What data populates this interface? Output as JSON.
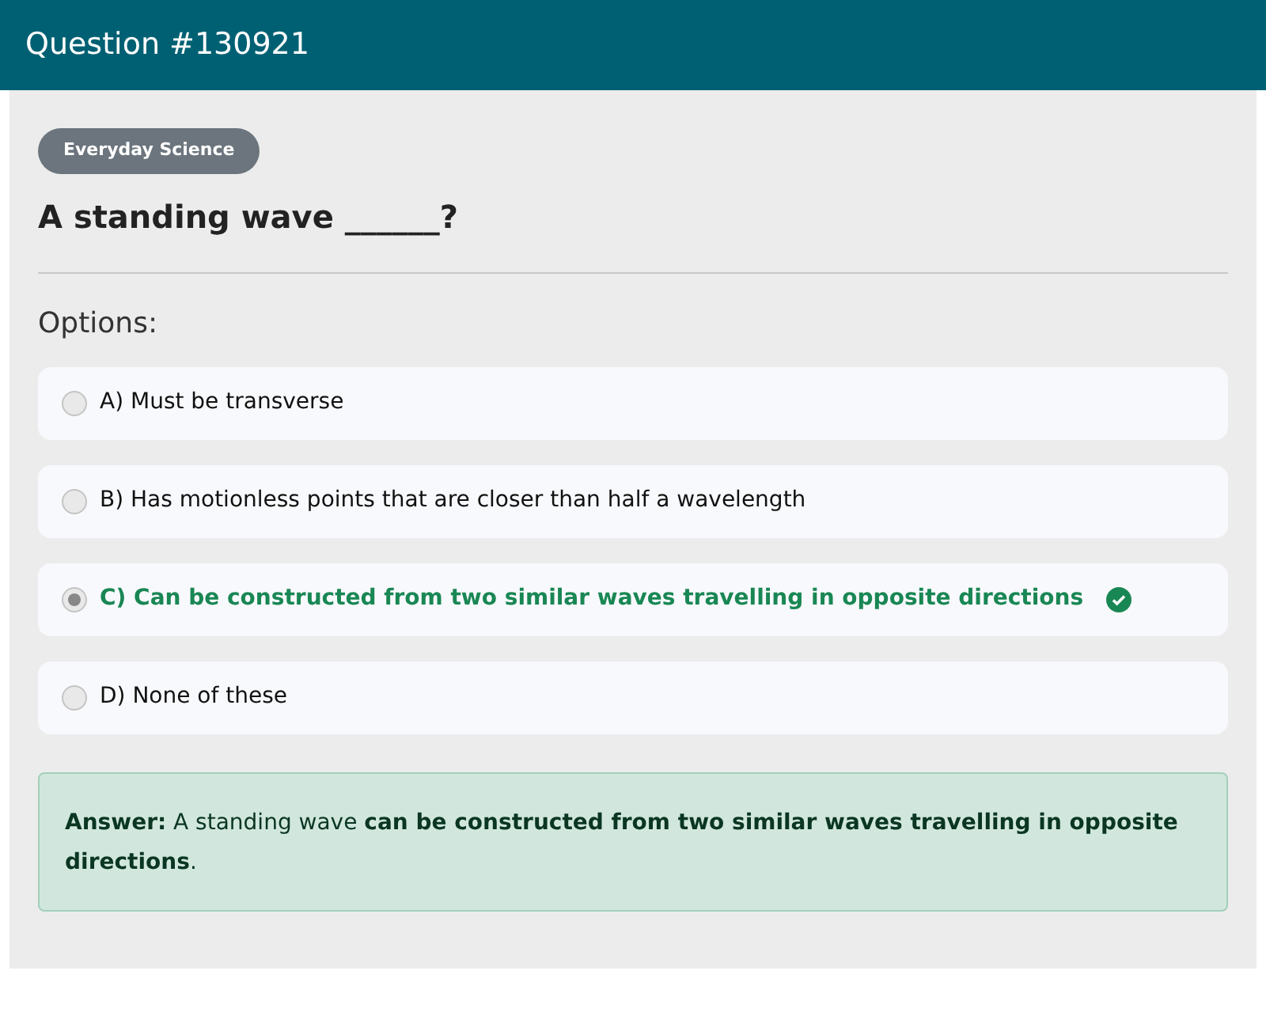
{
  "header": {
    "title": "Question #130921"
  },
  "category": "Everyday Science",
  "question": "A standing wave ______?",
  "options_label": "Options:",
  "options": [
    {
      "text": "A) Must be transverse",
      "selected": false,
      "correct": false
    },
    {
      "text": "B) Has motionless points that are closer than half a wavelength",
      "selected": false,
      "correct": false
    },
    {
      "text": "C) Can be constructed from two similar waves travelling in opposite directions",
      "selected": true,
      "correct": true
    },
    {
      "text": "D) None of these",
      "selected": false,
      "correct": false
    }
  ],
  "answer": "**Answer:** A standing wave **can be constructed from two similar waves travelling in opposite directions**."
}
